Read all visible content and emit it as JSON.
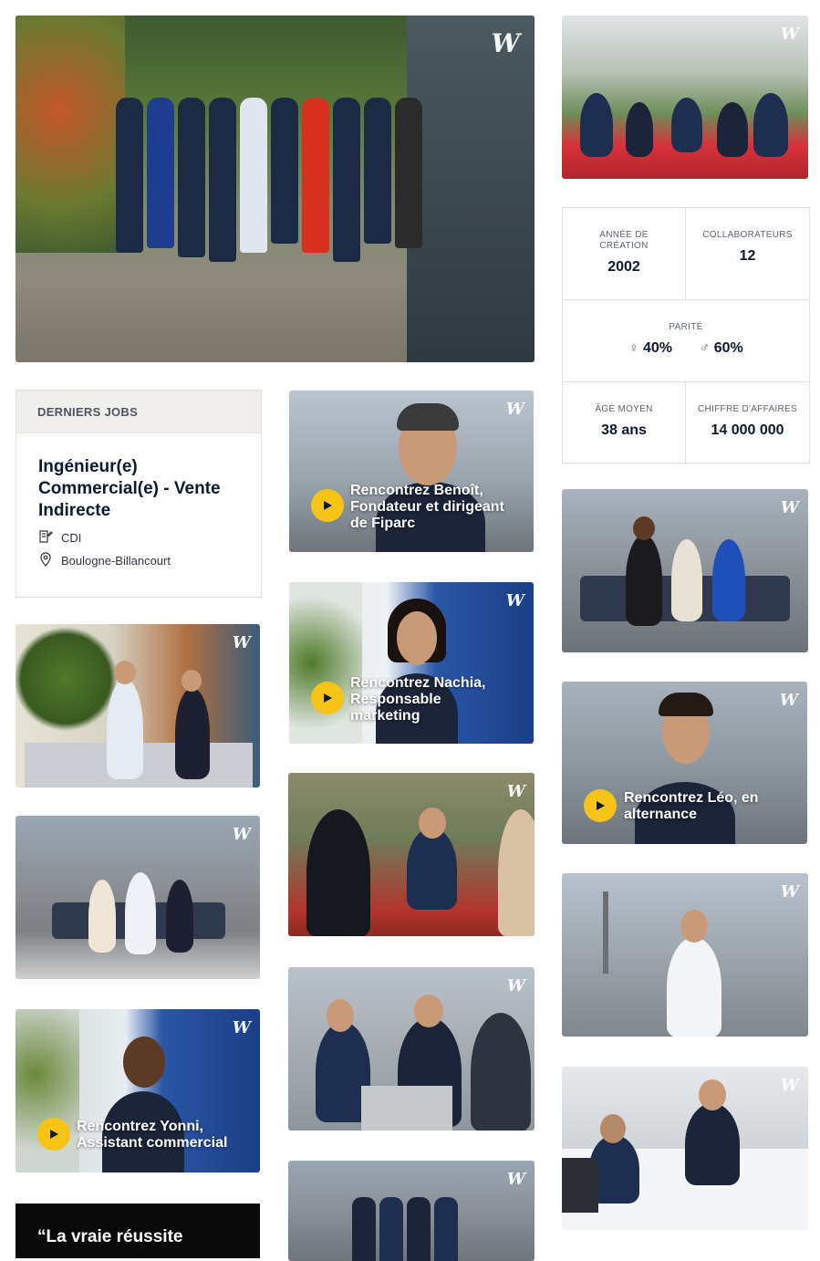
{
  "logo_text": "W",
  "jobs": {
    "header": "DERNIERS JOBS",
    "title": "Ingénieur(e) Commercial(e) - Vente Indirecte",
    "contract": "CDI",
    "location": "Boulogne-Billancourt"
  },
  "stats": {
    "founded_label": "ANNÉE DE CRÉATION",
    "founded_value": "2002",
    "employees_label": "COLLABORATEURS",
    "employees_value": "12",
    "parity_label": "PARITÉ",
    "female_pct": "40%",
    "male_pct": "60%",
    "age_label": "ÂGE MOYEN",
    "age_value": "38 ans",
    "revenue_label": "CHIFFRE D'AFFAIRES",
    "revenue_value": "14 000 000"
  },
  "videos": {
    "benoit": "Rencontrez Benoît, Fondateur et dirigeant de Fiparc",
    "nachia": "Rencontrez Nachia, Responsable marketing",
    "leo": "Rencontrez Léo, en alternance",
    "yonni": "Rencontrez Yonni, Assistant commercial"
  },
  "quote": "“La vraie réussite",
  "colors": {
    "accent_yellow": "#f6c416",
    "navy": "#0b1a2e"
  }
}
